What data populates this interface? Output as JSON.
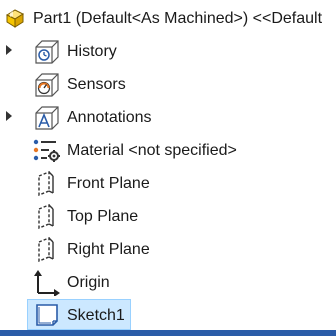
{
  "feature_tree": {
    "root": {
      "label": "Part1 (Default<As Machined>) <<Default",
      "icon": "part-icon"
    },
    "items": [
      {
        "label": "History",
        "icon": "history-icon",
        "expandable": true
      },
      {
        "label": "Sensors",
        "icon": "sensors-icon",
        "expandable": false
      },
      {
        "label": "Annotations",
        "icon": "annotations-icon",
        "expandable": true
      },
      {
        "label": "Material <not specified>",
        "icon": "material-icon",
        "expandable": false
      },
      {
        "label": "Front Plane",
        "icon": "plane-icon",
        "expandable": false
      },
      {
        "label": "Top Plane",
        "icon": "plane-icon",
        "expandable": false
      },
      {
        "label": "Right Plane",
        "icon": "plane-icon",
        "expandable": false
      },
      {
        "label": "Origin",
        "icon": "origin-icon",
        "expandable": false
      },
      {
        "label": "Sketch1",
        "icon": "sketch-icon",
        "expandable": false,
        "selected": true
      }
    ]
  },
  "colors": {
    "selection_fill": "#cce8ff",
    "selection_border": "#99d1ff",
    "part_icon_yellow": "#f5c400",
    "icon_blue": "#2a5ca8",
    "sensor_orange": "#e87722"
  }
}
